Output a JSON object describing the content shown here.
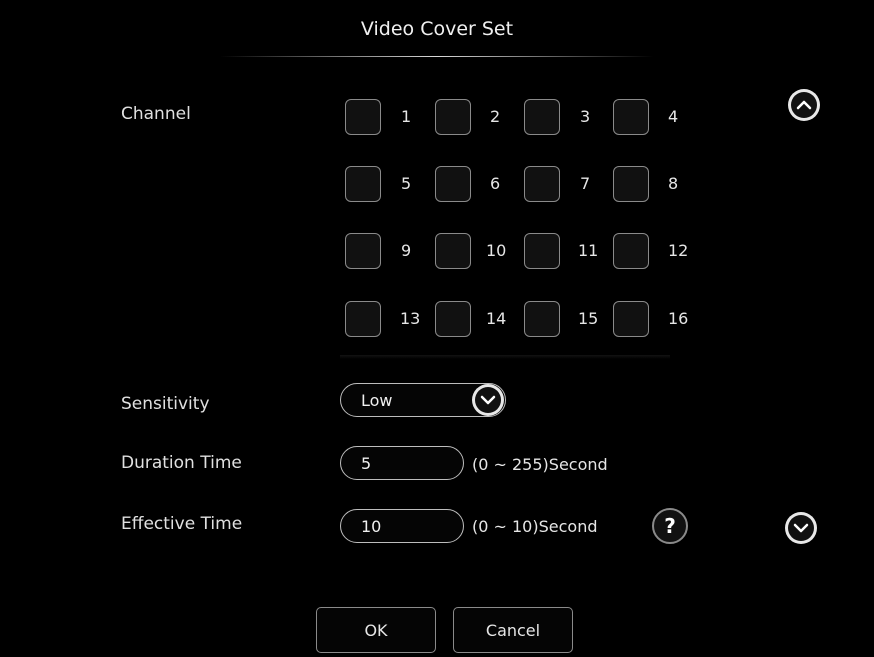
{
  "dialog": {
    "title": "Video Cover Set"
  },
  "channel": {
    "label": "Channel",
    "items": [
      "1",
      "2",
      "3",
      "4",
      "5",
      "6",
      "7",
      "8",
      "9",
      "10",
      "11",
      "12",
      "13",
      "14",
      "15",
      "16"
    ]
  },
  "sensitivity": {
    "label": "Sensitivity",
    "value": "Low"
  },
  "duration": {
    "label": "Duration Time",
    "value": "5",
    "unit": "(0 ~ 255)Second"
  },
  "effective": {
    "label": "Effective Time",
    "value": "10",
    "unit": "(0 ~ 10)Second"
  },
  "help": {
    "symbol": "?"
  },
  "buttons": {
    "ok": "OK",
    "cancel": "Cancel"
  },
  "icons": {
    "scroll_up": "chevron-up-icon",
    "scroll_down": "chevron-down-icon",
    "dropdown": "chevron-down-icon"
  }
}
